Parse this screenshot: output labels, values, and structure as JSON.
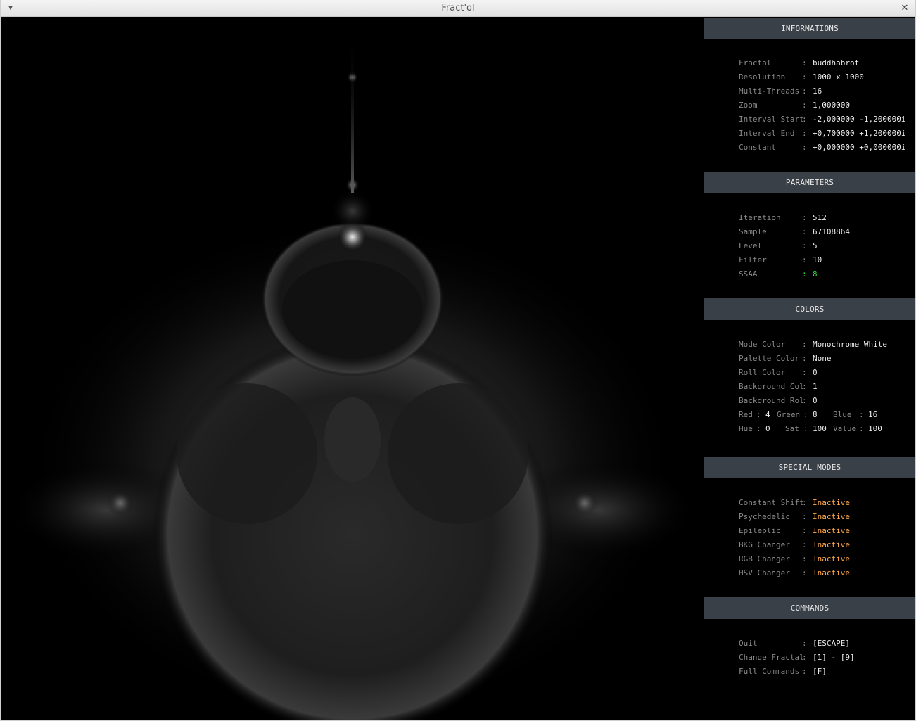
{
  "window": {
    "title": "Fract'ol"
  },
  "sections": {
    "informations": {
      "header": "INFORMATIONS",
      "rows": [
        {
          "key": "Fractal",
          "value": "buddhabrot"
        },
        {
          "key": "Resolution",
          "value": "1000 x 1000"
        },
        {
          "key": "Multi-Threads",
          "value": "16"
        },
        {
          "key": "Zoom",
          "value": "1,000000"
        },
        {
          "key": "Interval Start",
          "value": "-2,000000 -1,200000i"
        },
        {
          "key": "Interval End",
          "value": "+0,700000 +1,200000i"
        },
        {
          "key": "Constant",
          "value": "+0,000000 +0,000000i"
        }
      ]
    },
    "parameters": {
      "header": "PARAMETERS",
      "rows": [
        {
          "key": "Iteration",
          "value": "512"
        },
        {
          "key": "Sample",
          "value": "67108864"
        },
        {
          "key": "Level",
          "value": "5"
        },
        {
          "key": "Filter",
          "value": "10"
        },
        {
          "key": "SSAA",
          "value": "8"
        }
      ]
    },
    "colors": {
      "header": "COLORS",
      "rows": [
        {
          "key": "Mode Color",
          "value": "Monochrome White"
        },
        {
          "key": "Palette Color",
          "value": "None"
        },
        {
          "key": "Roll Color",
          "value": "0"
        },
        {
          "key": "Background Col",
          "value": "1"
        },
        {
          "key": "Background Rol",
          "value": "0"
        }
      ],
      "rgb": {
        "red_label": "Red",
        "red": "4",
        "green_label": "Green",
        "green": "8",
        "blue_label": "Blue",
        "blue": "16"
      },
      "hsv": {
        "hue_label": "Hue",
        "hue": "0",
        "sat_label": "Sat",
        "sat": "100",
        "value_label": "Value",
        "value": "100"
      }
    },
    "special_modes": {
      "header": "SPECIAL MODES",
      "rows": [
        {
          "key": "Constant Shift",
          "value": "Inactive"
        },
        {
          "key": "Psychedelic",
          "value": "Inactive"
        },
        {
          "key": "Epileplic",
          "value": "Inactive"
        },
        {
          "key": "BKG Changer",
          "value": "Inactive"
        },
        {
          "key": "RGB Changer",
          "value": "Inactive"
        },
        {
          "key": "HSV Changer",
          "value": "Inactive"
        }
      ]
    },
    "commands": {
      "header": "COMMANDS",
      "rows": [
        {
          "key": "Quit",
          "value": "[ESCAPE]"
        },
        {
          "key": "Change Fractal",
          "value": "[1] - [9]"
        },
        {
          "key": "Full Commands",
          "value": "[F]"
        }
      ]
    }
  },
  "separator": ":",
  "colors": {
    "header_bg": "#3a4048",
    "label": "#8a8a8a",
    "value": "#ececec",
    "highlight_green": "#35d635",
    "inactive_orange": "#ffa94a"
  },
  "icons": {
    "window_menu": "chevron-down-icon",
    "minimize": "minimize-icon",
    "close": "close-icon"
  }
}
